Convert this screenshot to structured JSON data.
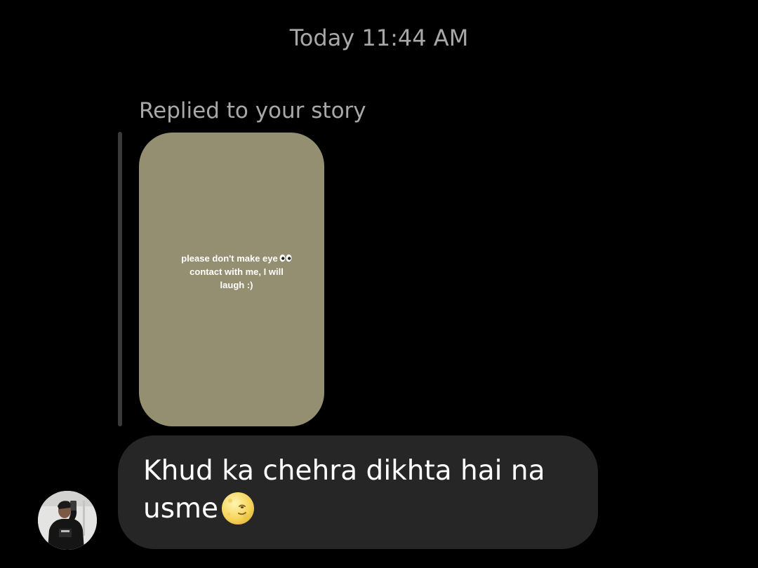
{
  "header": {
    "timestamp": "Today 11:44 AM"
  },
  "reply": {
    "context_label": "Replied to your story",
    "story": {
      "background_color": "#958f72",
      "text_lines": [
        "please don't make eye",
        "contact with me, I will",
        "laugh  :)"
      ],
      "emoji_icon": "eyes-icon"
    }
  },
  "message": {
    "lines": [
      "Khud ka chehra dikhta hai na",
      "usme"
    ],
    "emoji_icon": "smirking-moon-face-icon",
    "bubble_color": "#262626"
  },
  "sender": {
    "avatar_icon": "avatar-photo"
  },
  "colors": {
    "background": "#000000",
    "secondary_text": "#a8a8a8",
    "reply_bar": "#3a3a3a"
  }
}
